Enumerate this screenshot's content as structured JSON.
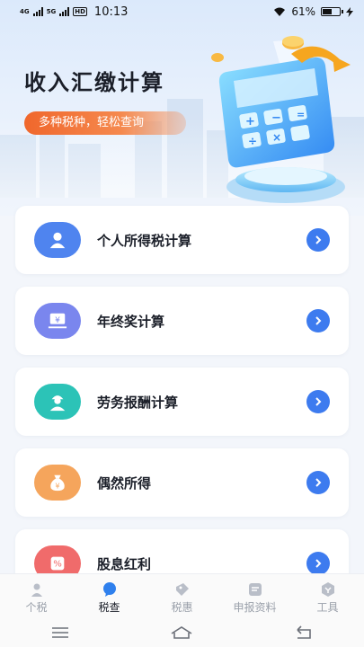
{
  "status": {
    "net1": "4G",
    "net2": "5G",
    "hd": "HD",
    "time": "10:13",
    "battery": "61%",
    "battery_level": 0.61
  },
  "header": {
    "title": "收入汇缴计算",
    "subtitle": "多种税种，轻松查询"
  },
  "items": [
    {
      "label": "个人所得税计算",
      "icon": "person-icon",
      "color": "#4f84ef"
    },
    {
      "label": "年终奖计算",
      "icon": "yen-laptop-icon",
      "color": "#7a86ee"
    },
    {
      "label": "劳务报酬计算",
      "icon": "worker-icon",
      "color": "#2cc3b7"
    },
    {
      "label": "偶然所得",
      "icon": "money-bag-icon",
      "color": "#f5a55c"
    },
    {
      "label": "股息红利",
      "icon": "percent-icon",
      "color": "#f06b6b"
    }
  ],
  "tabs": [
    {
      "label": "个税",
      "icon": "person-tab-icon",
      "active": false
    },
    {
      "label": "税查",
      "icon": "chat-tab-icon",
      "active": true
    },
    {
      "label": "税惠",
      "icon": "tag-tab-icon",
      "active": false
    },
    {
      "label": "申报资料",
      "icon": "document-tab-icon",
      "active": false
    },
    {
      "label": "工具",
      "icon": "tools-tab-icon",
      "active": false
    }
  ],
  "colors": {
    "accent": "#3d7bef",
    "subtitle_bg": "#f0672c"
  }
}
